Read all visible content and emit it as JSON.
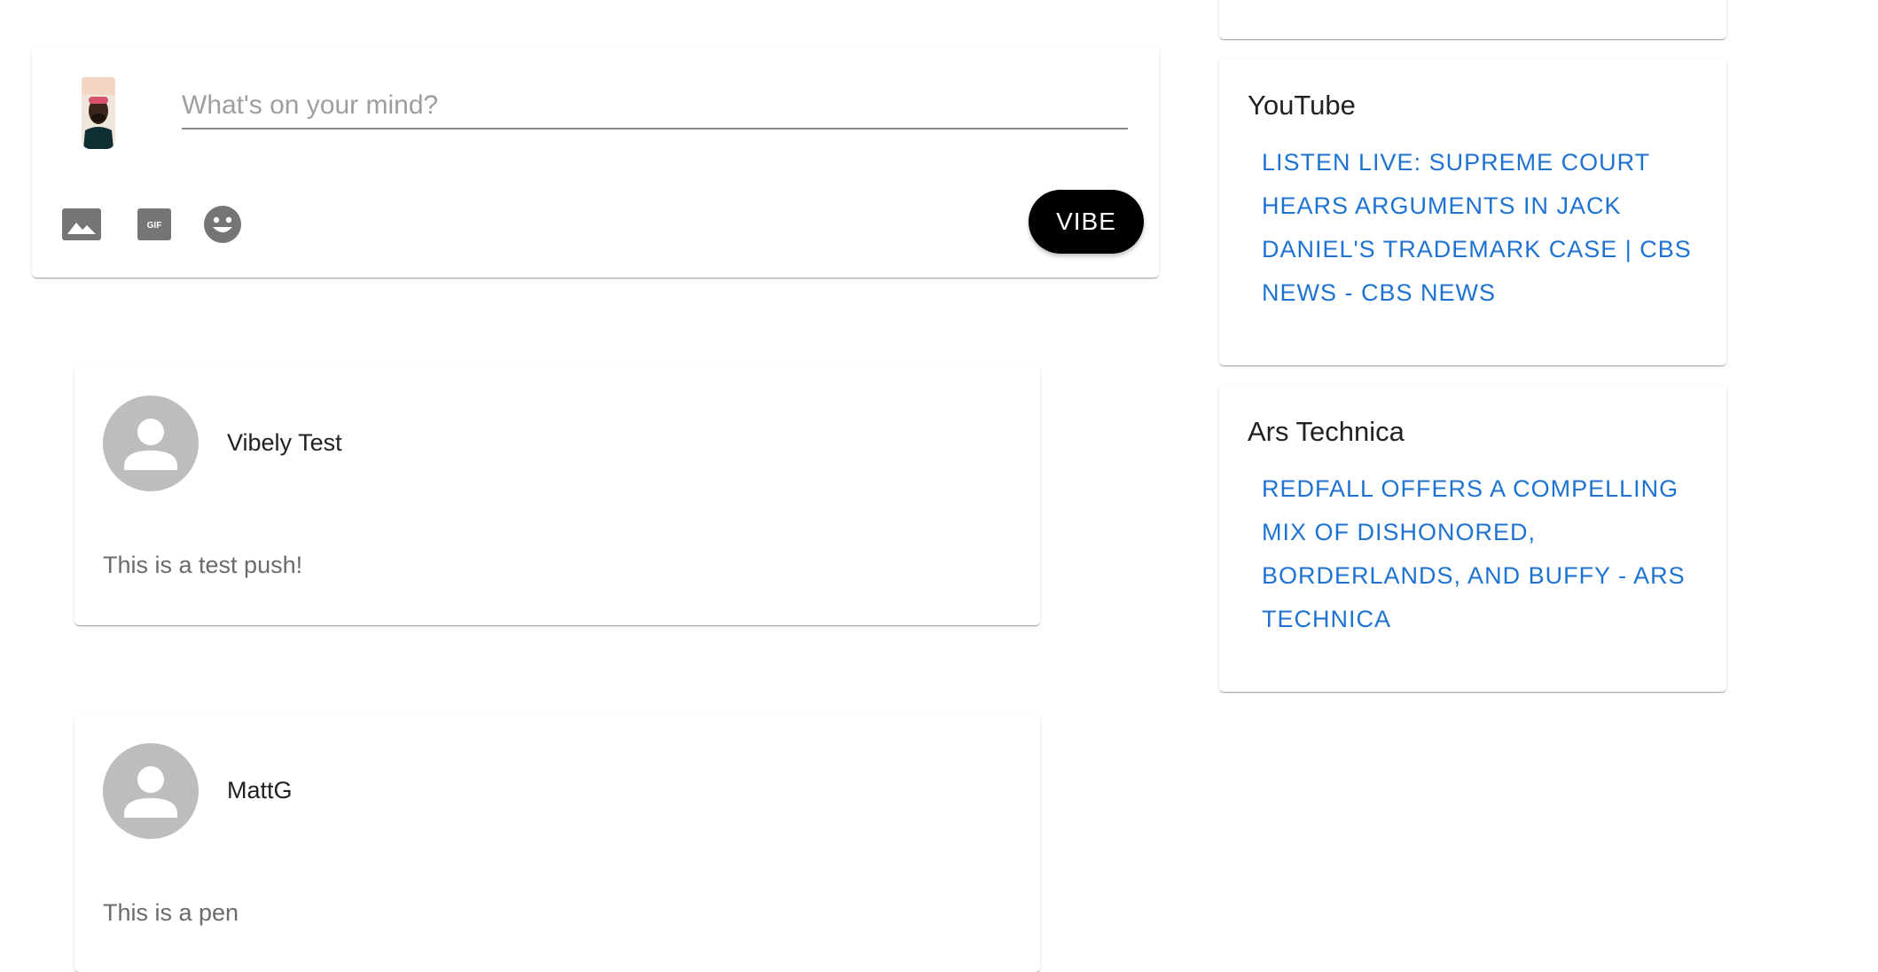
{
  "colors": {
    "accent_link": "#1e73d2",
    "button_bg": "#000000",
    "button_text": "#ffffff",
    "icon_gray": "#757575",
    "avatar_placeholder": "#bdbdbd"
  },
  "composer": {
    "placeholder": "What's on your mind?",
    "value": "",
    "user_avatar_icon": "user-photo",
    "tools": [
      {
        "icon": "image-icon"
      },
      {
        "icon": "gif-icon"
      },
      {
        "icon": "emoji-icon"
      }
    ],
    "submit_label": "VIBE"
  },
  "posts": [
    {
      "author": "Vibely Test",
      "avatar_icon": "person-icon",
      "body": "This is a test push!"
    },
    {
      "author": "MattG",
      "avatar_icon": "person-icon",
      "body": "This is a pen"
    }
  ],
  "news": [
    {
      "source": "YouTube",
      "headline": "LISTEN LIVE: SUPREME COURT HEARS ARGUMENTS IN JACK DANIEL'S TRADEMARK CASE | CBS NEWS - CBS NEWS"
    },
    {
      "source": "Ars Technica",
      "headline": "REDFALL OFFERS A COMPELLING MIX OF DISHONORED, BORDERLANDS, AND BUFFY - ARS TECHNICA"
    }
  ]
}
